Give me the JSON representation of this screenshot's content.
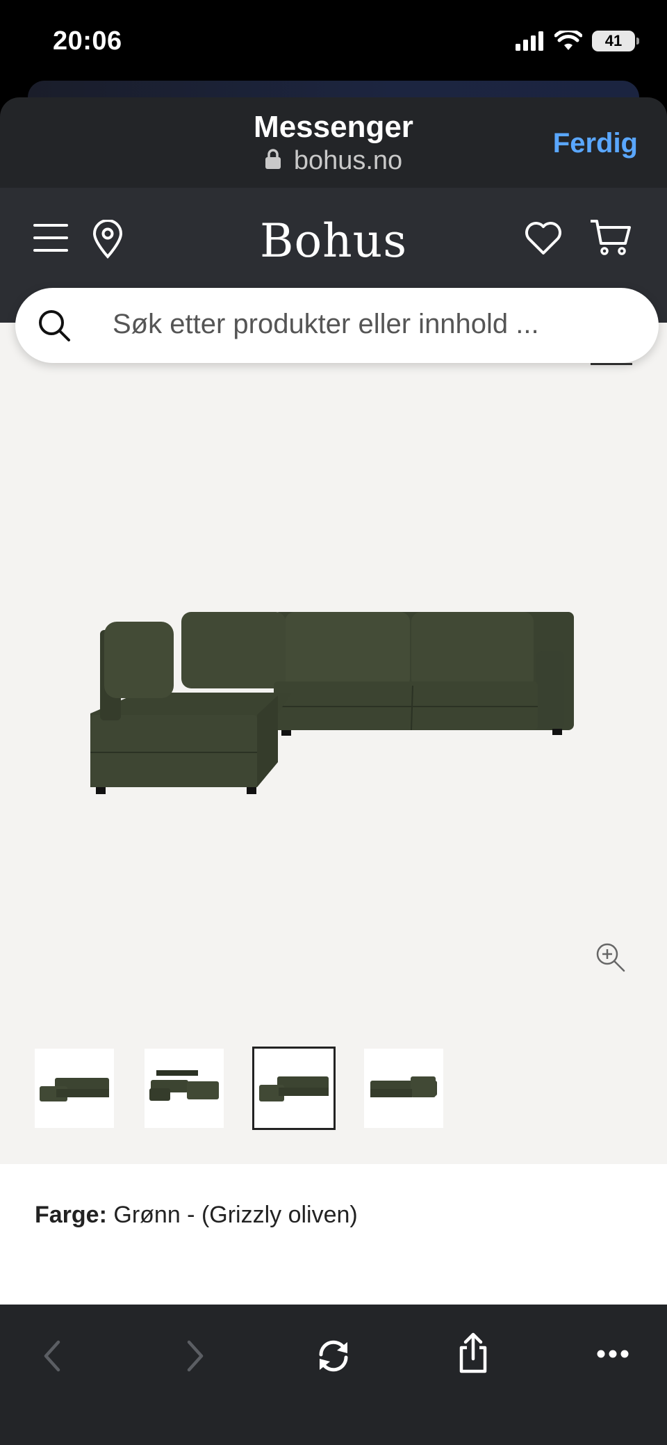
{
  "status_bar": {
    "time": "20:06",
    "battery": "41"
  },
  "sheet": {
    "title": "Messenger",
    "url": "bohus.no",
    "done_label": "Ferdig"
  },
  "site": {
    "logo": "Bohus"
  },
  "search": {
    "placeholder": "Søk etter produkter eller innhold ..."
  },
  "product": {
    "color_label": "Farge:",
    "color_value": "Grønn - (Grizzly oliven)",
    "thumbnail_count": 4,
    "active_thumbnail": 3
  },
  "toolbar": {
    "icons": [
      "back-icon",
      "forward-icon",
      "reload-icon",
      "share-icon",
      "more-icon"
    ]
  }
}
